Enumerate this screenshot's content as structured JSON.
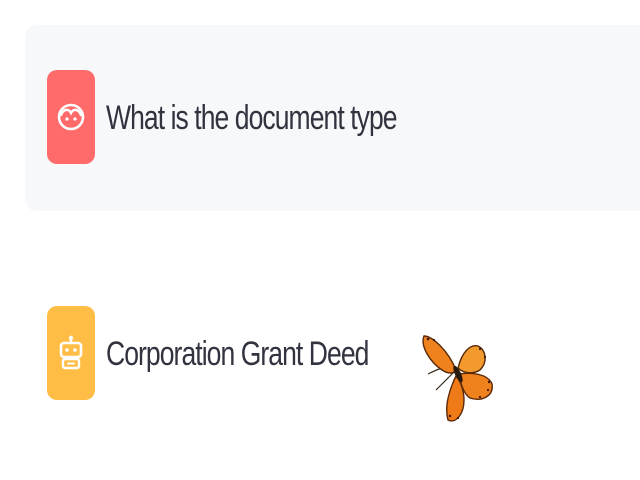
{
  "chat": {
    "messages": [
      {
        "role": "user",
        "avatar_icon": "user-face-icon",
        "avatar_color": "#ff6b6b",
        "text": "What is the document type"
      },
      {
        "role": "assistant",
        "avatar_icon": "robot-icon",
        "avatar_color": "#ffbd45",
        "text": "Corporation Grant Deed"
      }
    ],
    "decoration": {
      "icon": "butterfly-icon",
      "color": "#f0821e"
    }
  }
}
